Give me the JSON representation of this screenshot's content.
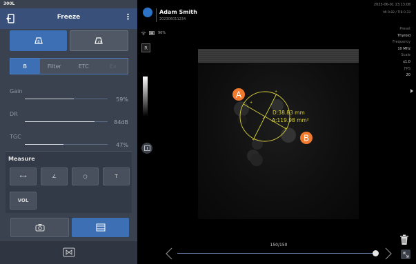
{
  "left_panel": {
    "probe": "300L",
    "header": {
      "title": "Freeze",
      "more_icon": "kebab-menu-icon",
      "exit_icon": "exit-icon"
    },
    "mode_buttons": [
      {
        "label": "B",
        "icon": "b-mode-icon",
        "active": true
      },
      {
        "label": "CF",
        "icon": "cf-mode-icon",
        "active": false
      }
    ],
    "tabs": [
      {
        "label": "B",
        "active": true
      },
      {
        "label": "Filter",
        "active": false
      },
      {
        "label": "ETC",
        "active": false
      },
      {
        "label": "Ex",
        "active": false,
        "dim": true
      }
    ],
    "params": [
      {
        "name": "Gain",
        "value": "59%",
        "level": 0.59
      },
      {
        "name": "DR",
        "value": "84dB",
        "level": 0.84
      },
      {
        "name": "TGC",
        "value": "47%",
        "level": 0.47
      }
    ],
    "measure": {
      "title": "Measure",
      "tools": [
        {
          "icon": "distance-icon",
          "label": "⟷"
        },
        {
          "icon": "angle-icon",
          "label": "∠"
        },
        {
          "icon": "ellipse-icon",
          "label": "○"
        },
        {
          "icon": "text-icon",
          "label": "T"
        },
        {
          "icon": "volume-icon",
          "label": "VOL"
        }
      ]
    },
    "bottom_buttons": [
      {
        "icon": "camera-icon",
        "active": false
      },
      {
        "icon": "layout-icon",
        "active": true
      }
    ],
    "footer_icon": "freeze-toggle-icon"
  },
  "image_area": {
    "patient_name": "Adam Smith",
    "patient_id": "202306011234",
    "datetime": "2023-06-01 13:13:08",
    "mi_ti": "MI 0.82 / TIB 0.33",
    "battery": "96%",
    "orientation": "R",
    "info": [
      {
        "key": "Preset",
        "value": "Thyroid"
      },
      {
        "key": "Frequency",
        "value": "10 MHz"
      },
      {
        "key": "Scale",
        "value": "x1.0"
      },
      {
        "key": "FPS",
        "value": "20"
      }
    ],
    "measurement": {
      "distance": "D:38.83 mm",
      "area": "A:119.98 mm²",
      "callout_a": "A",
      "callout_b": "B"
    },
    "cine": {
      "counter": "150/150",
      "position": 1.0
    },
    "accent_color": "#3c6fb3",
    "measure_color": "#d9d23a",
    "callout_color": "#f07a2e"
  }
}
